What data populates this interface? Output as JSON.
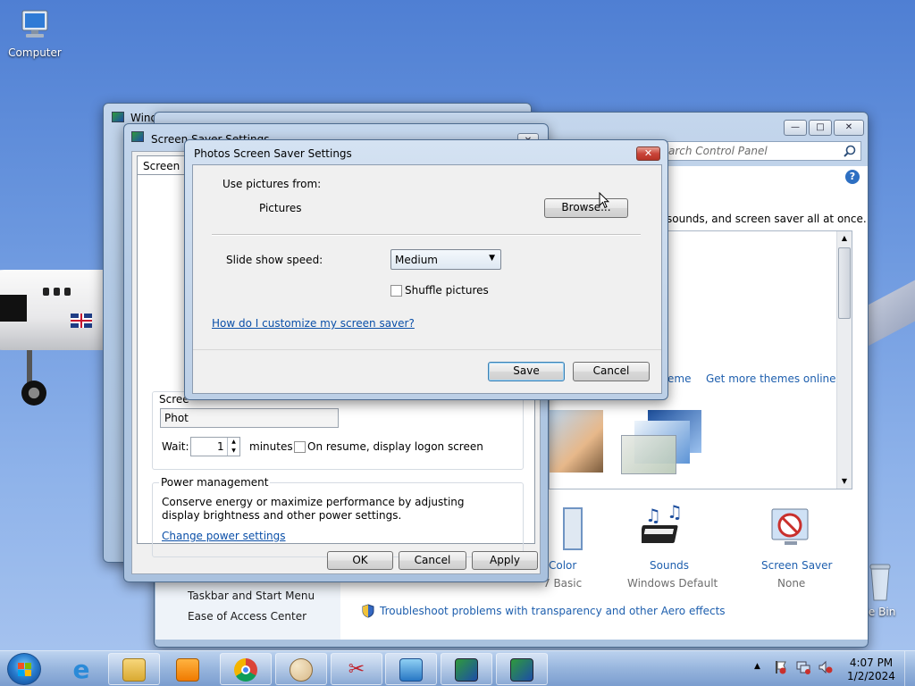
{
  "desktop": {
    "icons": [
      {
        "label": "Computer"
      },
      {
        "label": "Recycle Bin",
        "visible_label": "cle Bin"
      }
    ]
  },
  "personalization_window": {
    "search_placeholder": "Search Control Panel",
    "description_fragment": "sounds, and screen saver all at once.",
    "links": {
      "save_theme_fragment": "eme",
      "get_more_themes": "Get more themes online"
    },
    "bottom_items": [
      {
        "label": "Color",
        "sublabel": "7 Basic"
      },
      {
        "label": "Sounds",
        "sublabel": "Windows Default"
      },
      {
        "label": "Screen Saver",
        "sublabel": "None"
      }
    ],
    "see_also": [
      "Taskbar and Start Menu",
      "Ease of Access Center"
    ],
    "troubleshoot_link": "Troubleshoot problems with transparency and other Aero effects"
  },
  "back_window": {
    "title_fragment": "Wind"
  },
  "screen_saver_settings": {
    "title_fragment": "Screen Saver Settings",
    "tab_fragment": "Screen Sa",
    "group_label_fragment": "Scree",
    "selected_saver_fragment": "Phot",
    "wait_label": "Wait:",
    "wait_value": "1",
    "minutes_label": "minutes",
    "resume_label": "On resume, display logon screen",
    "power_group_label": "Power management",
    "power_text": "Conserve energy or maximize performance by adjusting display brightness and other power settings.",
    "power_link": "Change power settings",
    "ok_label": "OK",
    "cancel_label": "Cancel",
    "apply_label": "Apply"
  },
  "photos_dialog": {
    "title": "Photos Screen Saver Settings",
    "use_pictures_label": "Use pictures from:",
    "pictures_value": "Pictures",
    "browse_label": "Browse...",
    "speed_label": "Slide show speed:",
    "speed_value": "Medium",
    "shuffle_label": "Shuffle pictures",
    "shuffle_checked": false,
    "help_link": "How do I customize my screen saver?",
    "save_label": "Save",
    "cancel_label": "Cancel"
  },
  "taskbar": {
    "pinned": [
      "internet-explorer",
      "file-explorer",
      "media-player",
      "chrome",
      "paint",
      "snipping-tool",
      "control-panel",
      "display-settings",
      "display-settings-2"
    ],
    "clock_time": "4:07 PM",
    "clock_date": "1/2/2024"
  },
  "colors": {
    "link": "#0a4fa8",
    "close_red": "#c9453a",
    "taskbar": "#8fb0db"
  }
}
